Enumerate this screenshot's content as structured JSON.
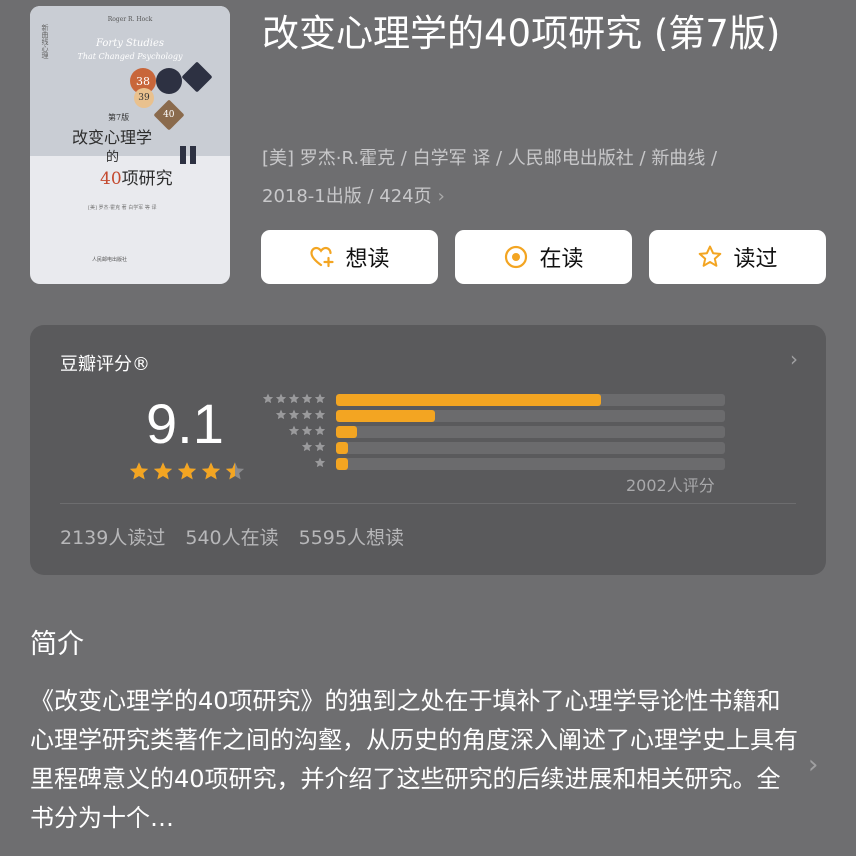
{
  "book": {
    "title": "改变心理学的40项研究 (第7版)",
    "meta_line1": "[美] 罗杰·R.霍克 / 白学军 译 / 人民邮电出版社 / 新曲线 /",
    "meta_line2": "2018-1出版 / 424页",
    "meta_chevron": "›"
  },
  "cover": {
    "author_small": "Roger R. Hock",
    "vertical_label": "新曲线心理",
    "en_title1": "Forty Studies",
    "en_title2": "That Changed Psychology",
    "edition": "第7版",
    "zh_title1": "改变心理学",
    "zh_title2": "的",
    "zh_title3_num": "40",
    "zh_title3_rest": "项研究",
    "circle_a": "38",
    "circle_b": "39",
    "circle_c": "40",
    "translators": "[美] 罗杰·霍克 著  白学军 等 译",
    "publisher": "人民邮电出版社"
  },
  "actions": [
    {
      "label": "想读",
      "icon": "heart-plus-icon"
    },
    {
      "label": "在读",
      "icon": "radio-dot-icon"
    },
    {
      "label": "读过",
      "icon": "star-outline-icon"
    }
  ],
  "colors": {
    "accent": "#f3a522",
    "background": "#6e6e70",
    "card": "#5a5a5c"
  },
  "rating": {
    "title": "豆瓣评分®",
    "chevron": "›",
    "score": "9.1",
    "stars": 4.5,
    "distribution": [
      {
        "stars": 5,
        "fraction": 0.68
      },
      {
        "stars": 4,
        "fraction": 0.255
      },
      {
        "stars": 3,
        "fraction": 0.055
      },
      {
        "stars": 2,
        "fraction": 0.03
      },
      {
        "stars": 1,
        "fraction": 0.03
      }
    ],
    "count_label": "2002人评分",
    "stats": {
      "read": "2139人读过",
      "reading": "540人在读",
      "want": "5595人想读"
    }
  },
  "intro": {
    "heading": "简介",
    "text": "《改变心理学的40项研究》的独到之处在于填补了心理学导论性书籍和心理学研究类著作之间的沟壑，从历史的角度深入阐述了心理学史上具有里程碑意义的40项研究，并介绍了这些研究的后续进展和相关研究。全书分为十个…",
    "chevron": "›"
  }
}
